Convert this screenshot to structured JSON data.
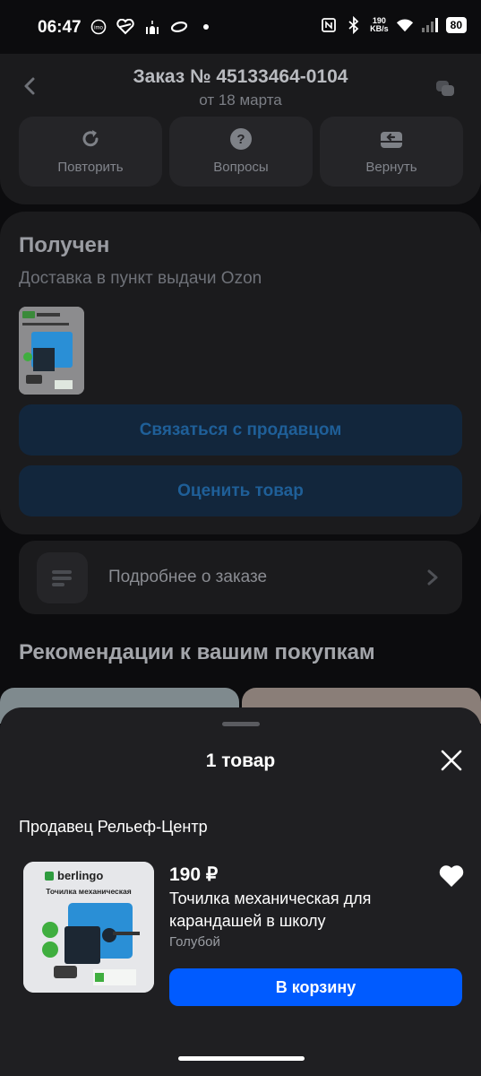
{
  "status_bar": {
    "time": "06:47",
    "left_icons": [
      "imo-icon",
      "heart-app-icon",
      "mosque-icon",
      "ring-icon",
      "dot-icon"
    ],
    "net_speed_value": "190",
    "net_speed_unit": "KB/s",
    "battery": "80"
  },
  "order": {
    "title": "Заказ № 45133464-0104",
    "date": "от 18 марта",
    "actions": [
      {
        "label": "Повторить",
        "icon": "repeat-icon"
      },
      {
        "label": "Вопросы",
        "icon": "question-icon"
      },
      {
        "label": "Вернуть",
        "icon": "return-icon"
      }
    ]
  },
  "status": {
    "title": "Получен",
    "subtitle": "Доставка в пункт выдачи Ozon",
    "contact_seller": "Связаться с продавцом",
    "rate_product": "Оценить товар"
  },
  "details_label": "Подробнее о заказе",
  "recommendations_title": "Рекомендации к вашим покупкам",
  "sheet": {
    "title": "1 товар",
    "seller": "Продавец Рельеф-Центр",
    "product": {
      "brand": "berlingo",
      "image_caption": "Точилка механическая",
      "price": "190 ₽",
      "name": "Точилка механическая для карандашей в школу",
      "variant": "Голубой"
    },
    "cart_button": "В корзину"
  },
  "colors": {
    "accent": "#005bff",
    "sheet_bg": "#1f1f22",
    "product_blue": "#2a8fd6"
  }
}
